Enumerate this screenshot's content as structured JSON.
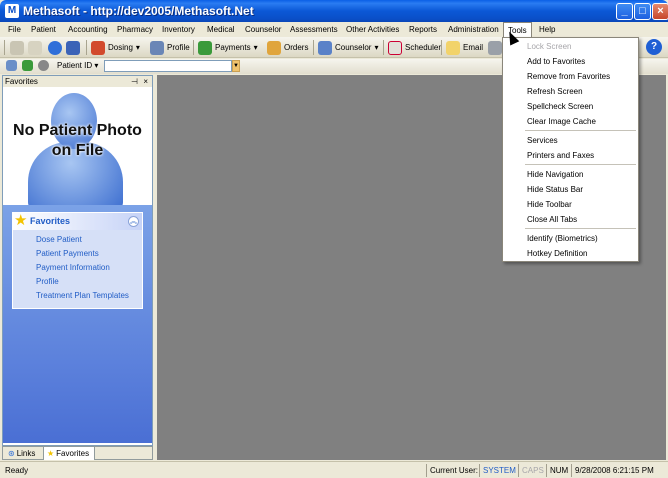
{
  "window": {
    "title": "Methasoft - http://dev2005/Methasoft.Net",
    "app_icon_letter": "M"
  },
  "menu": [
    "File",
    "Patient",
    "Accounting",
    "Pharmacy",
    "Inventory",
    "Medical",
    "Counselor",
    "Assessments",
    "Other Activities",
    "Reports",
    "Administration",
    "Tools",
    "Help"
  ],
  "toolbar": {
    "dosing": "Dosing",
    "profile": "Profile",
    "payments": "Payments",
    "orders": "Orders",
    "counselor": "Counselor",
    "scheduler": "Scheduler",
    "email": "Email",
    "help_glyph": "?"
  },
  "patient_search": {
    "label": "Patient ID",
    "value": ""
  },
  "favorites_pane": {
    "header": "Favorites",
    "photo_message_line1": "No Patient Photo",
    "photo_message_line2": "on File",
    "box_title": "Favorites",
    "links": [
      "Dose Patient",
      "Patient Payments",
      "Payment Information",
      "Profile",
      "Treatment Plan Templates"
    ],
    "tabs": [
      "Links",
      "Favorites"
    ]
  },
  "tools_menu": {
    "groups": [
      [
        {
          "label": "Lock Screen",
          "disabled": true
        },
        {
          "label": "Add to Favorites"
        },
        {
          "label": "Remove from Favorites"
        },
        {
          "label": "Refresh Screen"
        },
        {
          "label": "Spellcheck Screen"
        },
        {
          "label": "Clear Image Cache"
        }
      ],
      [
        {
          "label": "Services"
        },
        {
          "label": "Printers and Faxes"
        }
      ],
      [
        {
          "label": "Hide Navigation"
        },
        {
          "label": "Hide Status Bar"
        },
        {
          "label": "Hide Toolbar"
        },
        {
          "label": "Close All Tabs"
        }
      ],
      [
        {
          "label": "Identify (Biometrics)"
        },
        {
          "label": "Hotkey Definition"
        }
      ]
    ]
  },
  "status": {
    "ready": "Ready",
    "current_user_label": "Current User:",
    "current_user": "SYSTEM",
    "caps": "CAPS",
    "num": "NUM",
    "datetime": "9/28/2008 6:21:15 PM"
  },
  "colors": {
    "accent": "#215dc6",
    "workspace": "#808080",
    "disabled_text": "#a7a6aa"
  }
}
